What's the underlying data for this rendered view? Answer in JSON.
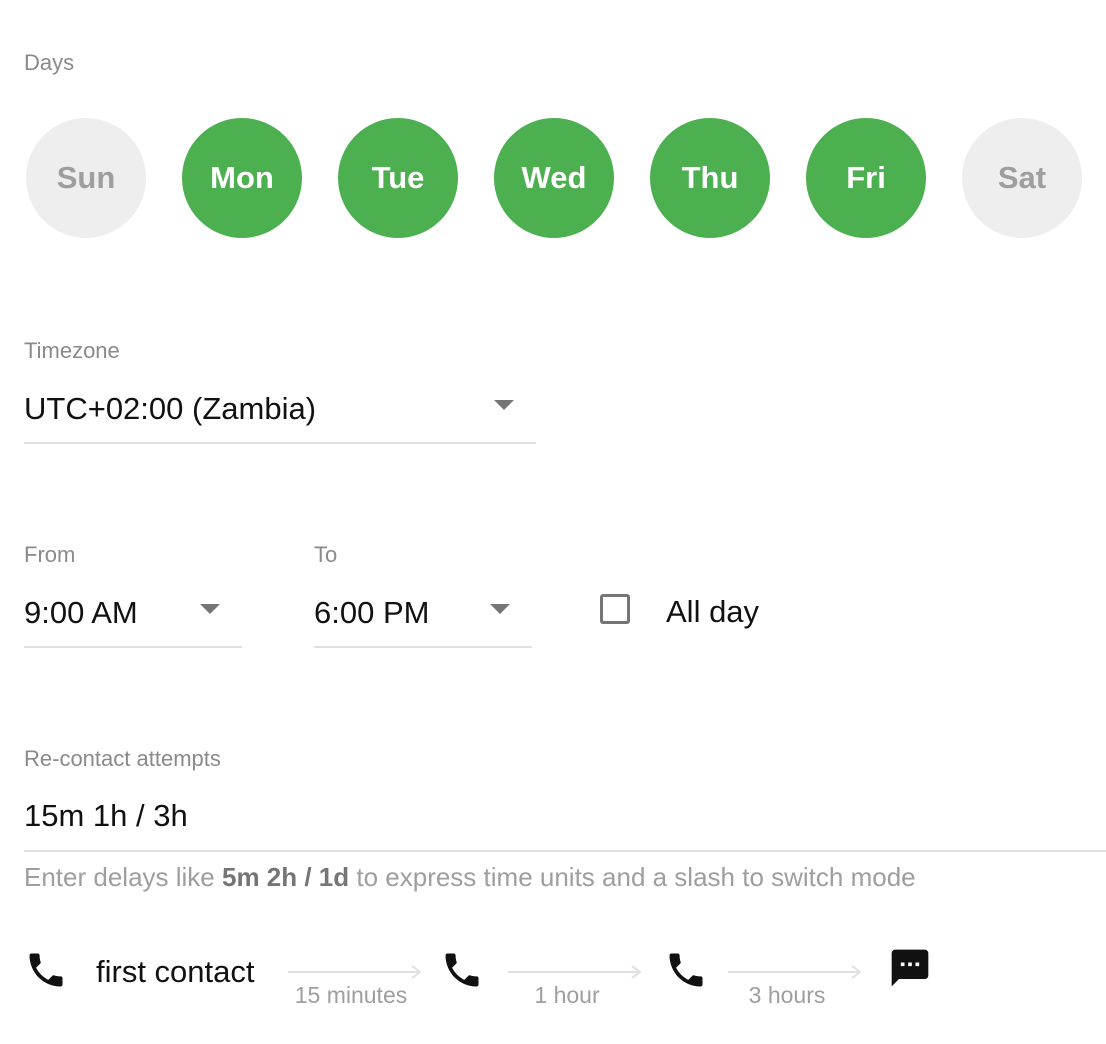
{
  "days": {
    "label": "Days",
    "items": [
      {
        "label": "Sun",
        "selected": false
      },
      {
        "label": "Mon",
        "selected": true
      },
      {
        "label": "Tue",
        "selected": true
      },
      {
        "label": "Wed",
        "selected": true
      },
      {
        "label": "Thu",
        "selected": true
      },
      {
        "label": "Fri",
        "selected": true
      },
      {
        "label": "Sat",
        "selected": false
      }
    ]
  },
  "timezone": {
    "label": "Timezone",
    "value": "UTC+02:00 (Zambia)"
  },
  "from": {
    "label": "From",
    "value": "9:00 AM"
  },
  "to": {
    "label": "To",
    "value": "6:00 PM"
  },
  "all_day": {
    "label": "All day",
    "checked": false
  },
  "recontact": {
    "label": "Re-contact attempts",
    "value": "15m 1h / 3h",
    "hint_before": "Enter delays like ",
    "hint_example": "5m 2h / 1d",
    "hint_after": " to express time units and a slash to switch mode"
  },
  "timeline": {
    "first_contact_label": "first contact",
    "delays": [
      "15 minutes",
      "1 hour",
      "3 hours"
    ],
    "icons": [
      "phone-icon",
      "phone-icon",
      "phone-icon",
      "sms-icon"
    ]
  },
  "colors": {
    "selected_day": "#4caf50",
    "unselected_day": "#eeeeee",
    "unselected_day_text": "#9e9e9e",
    "muted_label": "#8a8a8a"
  }
}
